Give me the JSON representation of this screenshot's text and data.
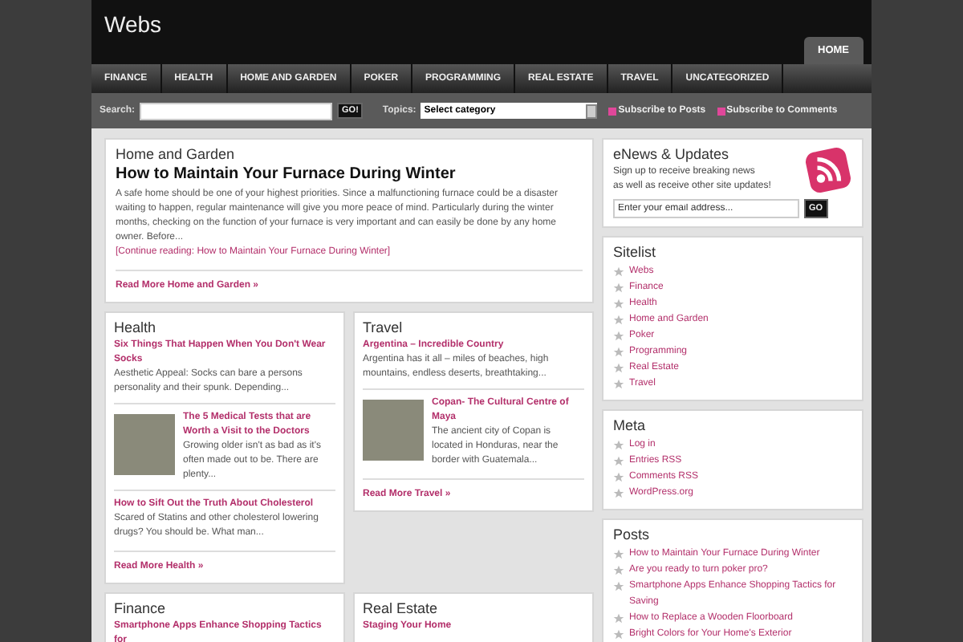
{
  "header": {
    "title": "Webs",
    "tabs": [
      {
        "label": "HOME",
        "selected": true
      }
    ]
  },
  "nav": [
    "FINANCE",
    "HEALTH",
    "HOME AND GARDEN",
    "POKER",
    "PROGRAMMING",
    "REAL ESTATE",
    "TRAVEL",
    "UNCATEGORIZED"
  ],
  "searchbar": {
    "label": "Search:",
    "button": "GO!",
    "topics_label": "Topics:",
    "topics_value": "Select category",
    "subscribe": [
      "Subscribe to Posts",
      "Subscribe to Comments"
    ]
  },
  "featured": {
    "category": "Home and Garden",
    "title": "How to Maintain Your Furnace During Winter",
    "excerpt": "A safe home should be one of your highest priorities. Since a malfunctioning furnace could be a disaster waiting to happen, regular maintenance will give you more peace of mind. Particularly during the winter months, checking on the function of your furnace is very important and can easily be done by any home owner. Before...",
    "continue": "[Continue reading: How to Maintain Your Furnace During Winter]",
    "more": "Read More Home and Garden »"
  },
  "sections": [
    {
      "title": "Health",
      "posts": [
        {
          "title": "Six Things That Happen When You Don't Wear Socks",
          "excerpt": "Aesthetic Appeal: Socks can bare a persons personality and their spunk. Depending...",
          "image": false
        },
        {
          "title": "The 5 Medical Tests that are Worth a Visit to the Doctors",
          "excerpt": "Growing older isn't as bad as it's often made out to be. There are plenty...",
          "image": true
        },
        {
          "title": "How to Sift Out the Truth About Cholesterol",
          "excerpt": "Scared of Statins and other cholesterol lowering drugs? You should be. What man...",
          "image": false
        }
      ],
      "more": "Read More Health »"
    },
    {
      "title": "Travel",
      "posts": [
        {
          "title": "Argentina – Incredible Country",
          "excerpt": "Argentina has it all – miles of beaches, high mountains, endless deserts, breathtaking...",
          "image": false
        },
        {
          "title": "Copan- The Cultural Centre of Maya",
          "excerpt": "The ancient city of Copan is located in Honduras, near the border with Guatemala...",
          "image": true
        }
      ],
      "more": "Read More Travel »"
    },
    {
      "title": "Finance",
      "posts": [
        {
          "title": "Smartphone Apps Enhance Shopping Tactics for",
          "image": false
        }
      ]
    },
    {
      "title": "Real Estate",
      "posts": [
        {
          "title": "Staging Your Home",
          "image": false
        }
      ]
    }
  ],
  "enews": {
    "title": "eNews & Updates",
    "text": [
      "Sign up to receive breaking news",
      "as well as receive other site updates!"
    ],
    "placeholder": "Enter your email address...",
    "button": "GO"
  },
  "widgets": [
    {
      "title": "Sitelist",
      "items": [
        "Webs",
        "Finance",
        "Health",
        "Home and Garden",
        "Poker",
        "Programming",
        "Real Estate",
        "Travel"
      ]
    },
    {
      "title": "Meta",
      "items": [
        "Log in",
        "Entries RSS",
        "Comments RSS",
        "WordPress.org"
      ]
    },
    {
      "title": "Posts",
      "items": [
        "How to Maintain Your Furnace During Winter",
        "Are you ready to turn poker pro?",
        "Smartphone Apps Enhance Shopping Tactics for Saving",
        "How to Replace a Wooden Floorboard",
        "Bright Colors for Your Home's Exterior"
      ]
    }
  ]
}
